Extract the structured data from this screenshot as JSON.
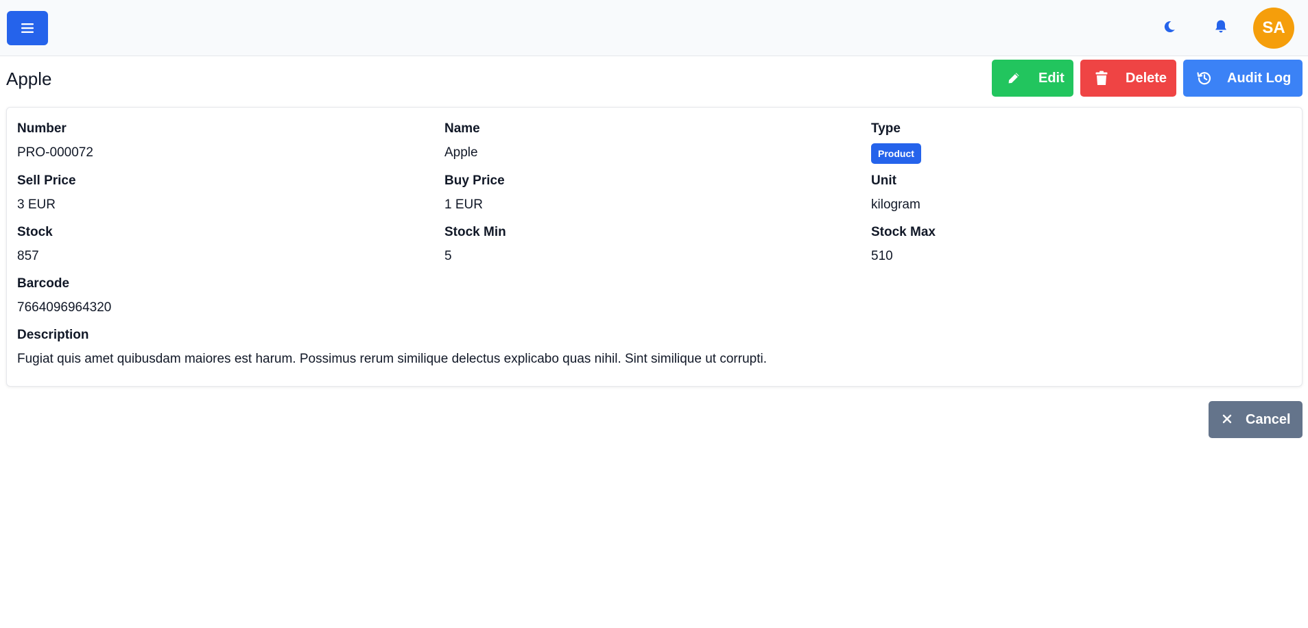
{
  "header": {
    "menu_icon": "hamburger-icon",
    "theme_icon": "moon-icon",
    "notifications_icon": "bell-icon",
    "avatar_initials": "SA"
  },
  "page": {
    "title": "Apple"
  },
  "actions": {
    "edit_label": "Edit",
    "delete_label": "Delete",
    "audit_label": "Audit Log"
  },
  "details": {
    "number_label": "Number",
    "number_value": "PRO-000072",
    "name_label": "Name",
    "name_value": "Apple",
    "type_label": "Type",
    "type_value": "Product",
    "sell_price_label": "Sell Price",
    "sell_price_value": "3 EUR",
    "buy_price_label": "Buy Price",
    "buy_price_value": "1 EUR",
    "unit_label": "Unit",
    "unit_value": "kilogram",
    "stock_label": "Stock",
    "stock_value": "857",
    "stock_min_label": "Stock Min",
    "stock_min_value": "5",
    "stock_max_label": "Stock Max",
    "stock_max_value": "510",
    "barcode_label": "Barcode",
    "barcode_value": "7664096964320",
    "description_label": "Description",
    "description_value": "Fugiat quis amet quibusdam maiores est harum. Possimus rerum similique delectus explicabo quas nihil. Sint similique ut corrupti."
  },
  "footer": {
    "cancel_label": "Cancel"
  },
  "colors": {
    "primary": "#2563eb",
    "edit": "#22c55e",
    "delete": "#ef4444",
    "audit": "#3b82f6",
    "cancel": "#64748b",
    "avatar": "#f59e0b"
  }
}
